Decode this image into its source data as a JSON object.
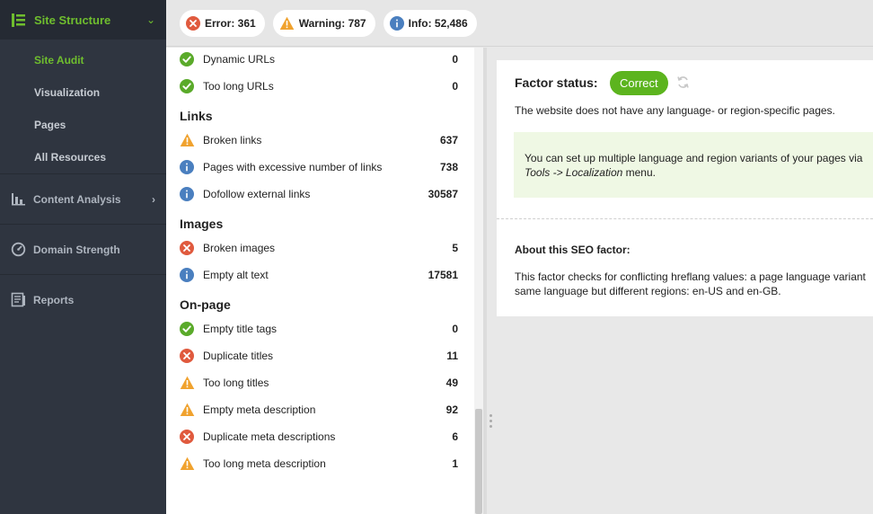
{
  "sidebar": {
    "header": {
      "label": "Site Structure",
      "icon": "site-structure-icon"
    },
    "sub_items": [
      {
        "label": "Site Audit",
        "active": true
      },
      {
        "label": "Visualization",
        "active": false
      },
      {
        "label": "Pages",
        "active": false
      },
      {
        "label": "All Resources",
        "active": false
      }
    ],
    "sections": [
      {
        "label": "Content Analysis",
        "icon": "content-analysis-icon",
        "has_arrow": true
      },
      {
        "label": "Domain Strength",
        "icon": "domain-strength-icon",
        "has_arrow": false
      },
      {
        "label": "Reports",
        "icon": "reports-icon",
        "has_arrow": false
      }
    ]
  },
  "summary": {
    "error_label": "Error: 361",
    "warning_label": "Warning: 787",
    "info_label": "Info: 52,486"
  },
  "issues": {
    "top_rows": [
      {
        "status": "correct",
        "name": "Dynamic URLs",
        "count": "0"
      },
      {
        "status": "correct",
        "name": "Too long URLs",
        "count": "0"
      }
    ],
    "categories": [
      {
        "title": "Links",
        "rows": [
          {
            "status": "warning",
            "name": "Broken links",
            "count": "637"
          },
          {
            "status": "info",
            "name": "Pages with excessive number of links",
            "count": "738"
          },
          {
            "status": "info",
            "name": "Dofollow external links",
            "count": "30587"
          }
        ]
      },
      {
        "title": "Images",
        "rows": [
          {
            "status": "error",
            "name": "Broken images",
            "count": "5"
          },
          {
            "status": "info",
            "name": "Empty alt text",
            "count": "17581"
          }
        ]
      },
      {
        "title": "On-page",
        "rows": [
          {
            "status": "correct",
            "name": "Empty title tags",
            "count": "0"
          },
          {
            "status": "error",
            "name": "Duplicate titles",
            "count": "11"
          },
          {
            "status": "warning",
            "name": "Too long titles",
            "count": "49"
          },
          {
            "status": "warning",
            "name": "Empty meta description",
            "count": "92"
          },
          {
            "status": "error",
            "name": "Duplicate meta descriptions",
            "count": "6"
          },
          {
            "status": "warning",
            "name": "Too long meta description",
            "count": "1"
          }
        ]
      }
    ]
  },
  "detail": {
    "factor_label": "Factor status:",
    "status_badge": "Correct",
    "description": "The website does not have any language- or region-specific pages.",
    "tip_line1": "You can set up multiple language and region variants of your pages via",
    "tip_line2_a": "Tools -> Localization",
    "tip_line2_b": " menu.",
    "about_heading": "About this SEO factor:",
    "about_line1": "This factor checks for conflicting hreflang values: a page language variant",
    "about_line2": "same language but different regions: en-US and en-GB."
  },
  "colors": {
    "accent_green": "#6fbe2e",
    "error_red": "#e05a3e",
    "warning_orange": "#f0a22e",
    "info_blue": "#4a7fbf",
    "correct_green": "#5aaa2a"
  }
}
